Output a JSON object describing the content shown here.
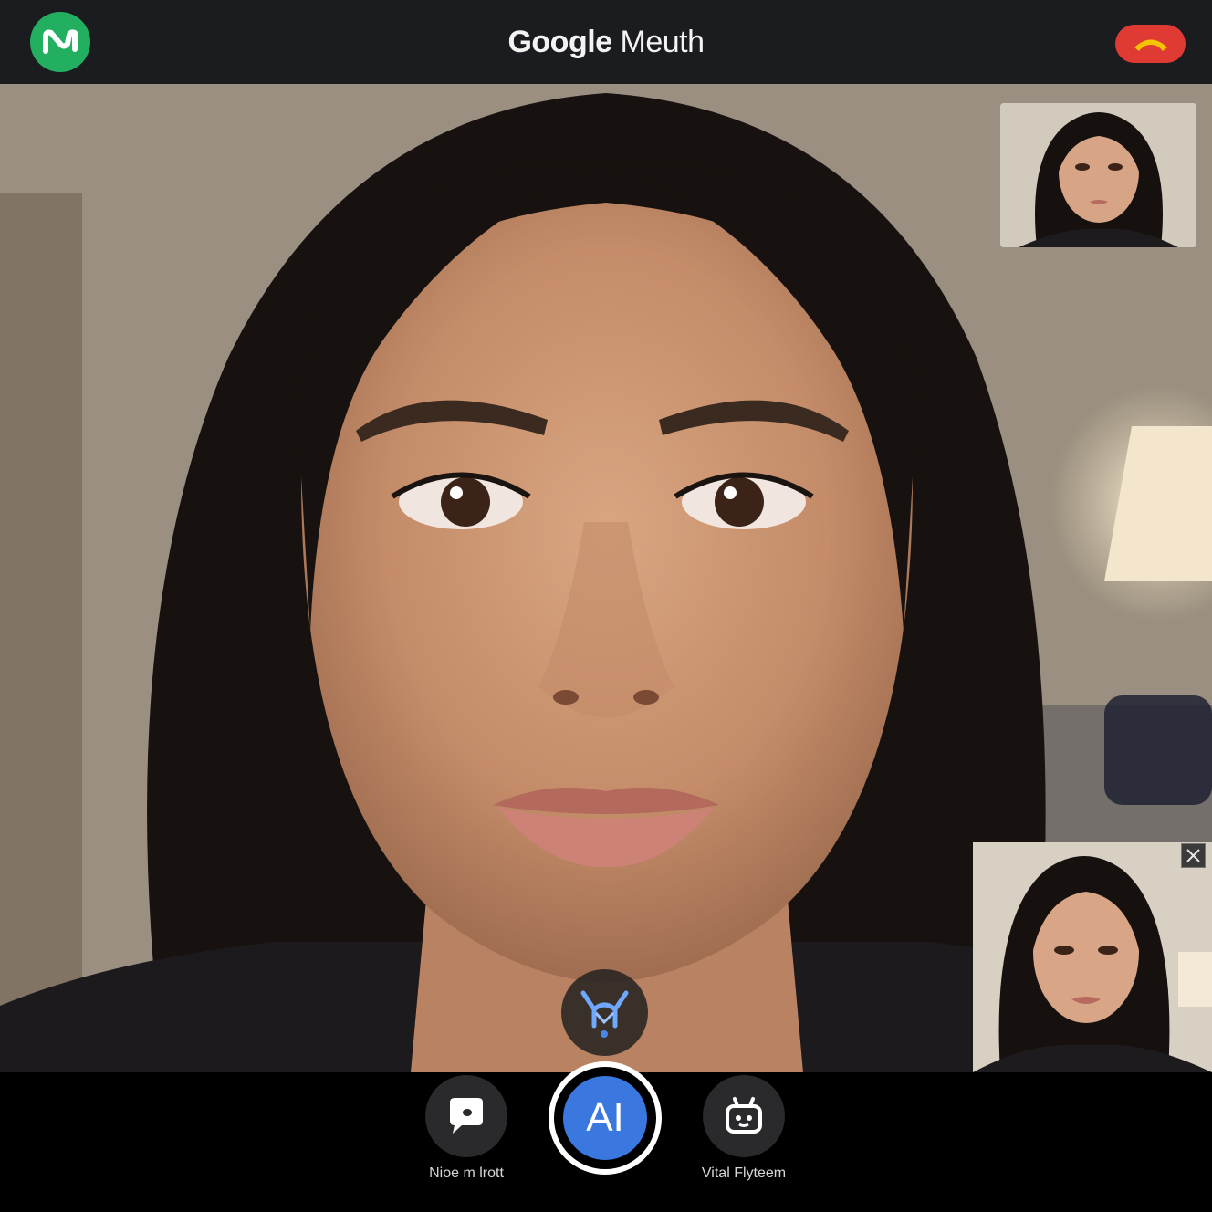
{
  "header": {
    "brand": "Google",
    "product": "Meuth",
    "logo_icon": "wave-logo-icon",
    "end_call_icon": "end-call-icon"
  },
  "video": {
    "main_participant": "participant-face",
    "thumbnails": [
      "self-view-top",
      "self-view-bottom"
    ],
    "close_icon": "close-icon",
    "effects_icon": "effects-icon"
  },
  "controls": {
    "left_label": "Nioe m lrott",
    "ai_label": "AI",
    "right_label": "Vital Flyteem",
    "left_icon": "chat-bubble-icon",
    "right_icon": "robot-icon"
  },
  "colors": {
    "accent_blue": "#3a78e0",
    "logo_green": "#22b060",
    "end_call_red": "#df3a34",
    "topbar": "#1b1c1f"
  }
}
